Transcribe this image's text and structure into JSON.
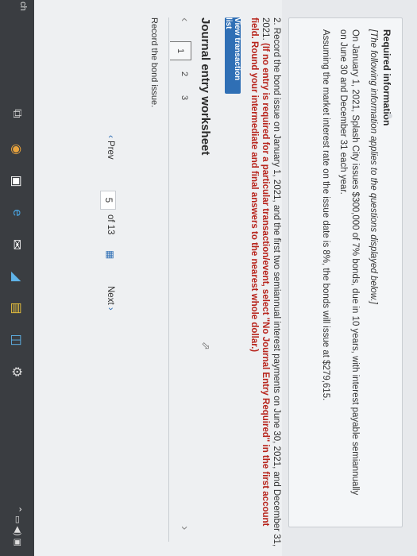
{
  "info": {
    "title": "Required information",
    "italic": "[The following information applies to the questions displayed below.]",
    "paragraph1": "On January 1, 2021, Splash City issues $300,000 of 7% bonds, due in 10 years, with interest payable semiannually on June 30 and December 31 each year.",
    "paragraph2": "Assuming the market interest rate on the issue date is 8%, the bonds will issue at $279,615."
  },
  "question": {
    "text": "2. Record the bond issue on January 1, 2021, and the first two semiannual interest payments on June 30, 2021, and December 31, 2021.",
    "red": "(If no entry is required for a particular transaction/event, select \"No Journal Entry Required\" in the first account field. Round your intermediate and final answers to the nearest whole dollar.)"
  },
  "view_transaction_list": "View transaction list",
  "worksheet_title": "Journal entry worksheet",
  "tabs": [
    "1",
    "2",
    "3"
  ],
  "record_instruction": "Record the bond issue.",
  "pager": {
    "prev": "Prev",
    "current": "5",
    "of": "of 13",
    "next": "Next"
  },
  "taskbar": {
    "left_text": "ch",
    "icons": [
      "search-icon",
      "task-view-icon",
      "chrome-icon",
      "store-icon",
      "edge-icon",
      "mail-icon",
      "files-icon",
      "settings-icon"
    ]
  }
}
